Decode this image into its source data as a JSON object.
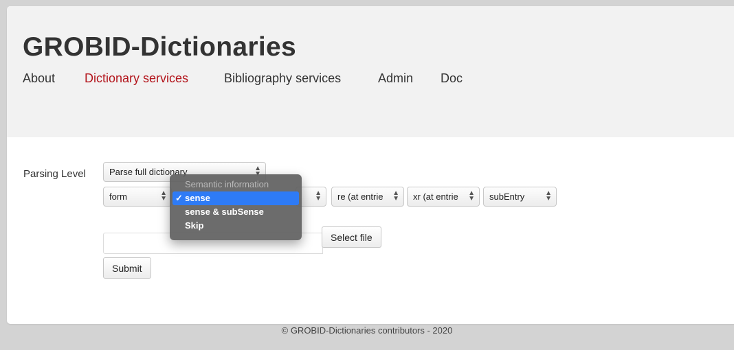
{
  "header": {
    "title": "GROBID-Dictionaries",
    "nav": [
      {
        "label": "About",
        "active": false
      },
      {
        "label": "Dictionary services",
        "active": true
      },
      {
        "label": "Bibliography services",
        "active": false
      },
      {
        "label": "Admin",
        "active": false
      },
      {
        "label": "Doc",
        "active": false
      }
    ]
  },
  "form": {
    "parsing_level_label": "Parsing Level",
    "parsing_level_value": "Parse full dictionary",
    "selects": [
      {
        "value": "form"
      },
      {
        "value": "re (at entrie"
      },
      {
        "value": "xr (at entrie"
      },
      {
        "value": "subEntry"
      }
    ],
    "select_file_label": "Select file",
    "submit_label": "Submit"
  },
  "dropdown": {
    "header": "Semantic information",
    "items": [
      {
        "label": "sense",
        "selected": true
      },
      {
        "label": "sense & subSense",
        "selected": false
      },
      {
        "label": "Skip",
        "selected": false
      }
    ],
    "check_mark": "✓"
  },
  "footer": {
    "text": "© GROBID-Dictionaries contributors - 2020"
  },
  "colors": {
    "accent_active_nav": "#b3151c",
    "dropdown_selected": "#2e7bf6",
    "header_bg": "#f2f2f2",
    "page_bg": "#d3d3d3"
  }
}
